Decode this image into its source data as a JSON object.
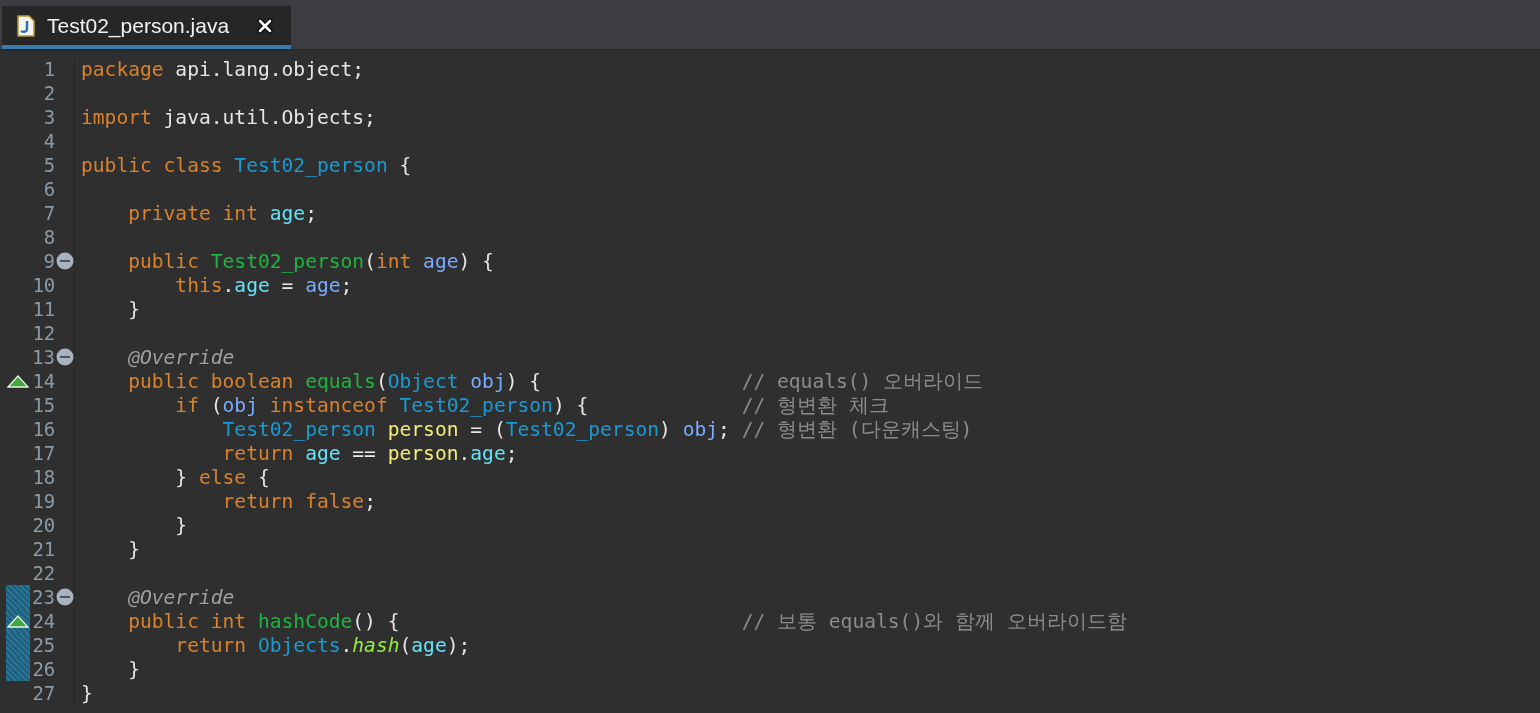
{
  "tabs": [
    {
      "title": "Test02_person.java",
      "selected": true
    }
  ],
  "lines": [
    {
      "number": "1",
      "collapsible": false,
      "overrides": false,
      "highlighted": false,
      "tokens": [
        {
          "text": "package",
          "kind": "keyword"
        },
        {
          "text": " api.lang.object;",
          "kind": "plain"
        }
      ]
    },
    {
      "number": "2",
      "collapsible": false,
      "overrides": false,
      "highlighted": false
    },
    {
      "number": "3",
      "collapsible": false,
      "overrides": false,
      "highlighted": false,
      "tokens": [
        {
          "text": "import",
          "kind": "keyword"
        },
        {
          "text": " java.util.Objects;",
          "kind": "plain"
        }
      ]
    },
    {
      "number": "4",
      "collapsible": false,
      "overrides": false,
      "highlighted": false
    },
    {
      "number": "5",
      "collapsible": false,
      "overrides": false,
      "highlighted": false,
      "tokens": [
        {
          "text": "public class ",
          "kind": "keyword"
        },
        {
          "text": "Test02_person",
          "kind": "type"
        },
        {
          "text": " {",
          "kind": "plain"
        }
      ]
    },
    {
      "number": "6",
      "collapsible": false,
      "overrides": false,
      "highlighted": false
    },
    {
      "number": "7",
      "collapsible": false,
      "overrides": false,
      "highlighted": false,
      "tokens": [
        {
          "text": "    private int ",
          "kind": "keyword"
        },
        {
          "text": "age",
          "kind": "field"
        },
        {
          "text": ";",
          "kind": "plain"
        }
      ]
    },
    {
      "number": "8",
      "collapsible": false,
      "overrides": false,
      "highlighted": false
    },
    {
      "number": "9",
      "collapsible": true,
      "overrides": false,
      "highlighted": false,
      "tokens": [
        {
          "text": "    public ",
          "kind": "keyword"
        },
        {
          "text": "Test02_person",
          "kind": "method"
        },
        {
          "text": "(",
          "kind": "plain"
        },
        {
          "text": "int ",
          "kind": "keyword"
        },
        {
          "text": "age",
          "kind": "param"
        },
        {
          "text": ") {",
          "kind": "plain"
        }
      ]
    },
    {
      "number": "10",
      "collapsible": false,
      "overrides": false,
      "highlighted": false,
      "tokens": [
        {
          "text": "        this",
          "kind": "keyword"
        },
        {
          "text": ".",
          "kind": "plain"
        },
        {
          "text": "age",
          "kind": "field"
        },
        {
          "text": " = ",
          "kind": "plain"
        },
        {
          "text": "age",
          "kind": "param"
        },
        {
          "text": ";",
          "kind": "plain"
        }
      ]
    },
    {
      "number": "11",
      "collapsible": false,
      "overrides": false,
      "highlighted": false,
      "tokens": [
        {
          "text": "    }",
          "kind": "plain"
        }
      ]
    },
    {
      "number": "12",
      "collapsible": false,
      "overrides": false,
      "highlighted": false
    },
    {
      "number": "13",
      "collapsible": true,
      "overrides": false,
      "highlighted": false,
      "tokens": [
        {
          "text": "    @Override",
          "kind": "annotation"
        }
      ]
    },
    {
      "number": "14",
      "collapsible": false,
      "overrides": true,
      "highlighted": false,
      "tokens": [
        {
          "text": "    public boolean ",
          "kind": "keyword"
        },
        {
          "text": "equals",
          "kind": "method"
        },
        {
          "text": "(",
          "kind": "plain"
        },
        {
          "text": "Object ",
          "kind": "type"
        },
        {
          "text": "obj",
          "kind": "param"
        },
        {
          "text": ") {",
          "kind": "plain"
        },
        {
          "text": "// equals() 오버라이드",
          "kind": "comment"
        }
      ]
    },
    {
      "number": "15",
      "collapsible": false,
      "overrides": false,
      "highlighted": false,
      "tokens": [
        {
          "text": "        if ",
          "kind": "keyword"
        },
        {
          "text": "(",
          "kind": "plain"
        },
        {
          "text": "obj",
          "kind": "param"
        },
        {
          "text": " instanceof ",
          "kind": "keyword"
        },
        {
          "text": "Test02_person",
          "kind": "type"
        },
        {
          "text": ") {",
          "kind": "plain"
        },
        {
          "text": "// 형변환 체크",
          "kind": "comment"
        }
      ]
    },
    {
      "number": "16",
      "collapsible": false,
      "overrides": false,
      "highlighted": false,
      "tokens": [
        {
          "text": "            Test02_person ",
          "kind": "type"
        },
        {
          "text": "person",
          "kind": "local"
        },
        {
          "text": " = (",
          "kind": "plain"
        },
        {
          "text": "Test02_person",
          "kind": "type"
        },
        {
          "text": ") ",
          "kind": "plain"
        },
        {
          "text": "obj",
          "kind": "param"
        },
        {
          "text": ";",
          "kind": "plain"
        },
        {
          "text": "// 형변환 (다운캐스팅)",
          "kind": "comment"
        }
      ]
    },
    {
      "number": "17",
      "collapsible": false,
      "overrides": false,
      "highlighted": false,
      "tokens": [
        {
          "text": "            return ",
          "kind": "keyword"
        },
        {
          "text": "age",
          "kind": "field"
        },
        {
          "text": " == ",
          "kind": "plain"
        },
        {
          "text": "person",
          "kind": "local"
        },
        {
          "text": ".",
          "kind": "plain"
        },
        {
          "text": "age",
          "kind": "field"
        },
        {
          "text": ";",
          "kind": "plain"
        }
      ]
    },
    {
      "number": "18",
      "collapsible": false,
      "overrides": false,
      "highlighted": false,
      "tokens": [
        {
          "text": "        } ",
          "kind": "plain"
        },
        {
          "text": "else",
          "kind": "keyword"
        },
        {
          "text": " {",
          "kind": "plain"
        }
      ]
    },
    {
      "number": "19",
      "collapsible": false,
      "overrides": false,
      "highlighted": false,
      "tokens": [
        {
          "text": "            return false",
          "kind": "keyword"
        },
        {
          "text": ";",
          "kind": "plain"
        }
      ]
    },
    {
      "number": "20",
      "collapsible": false,
      "overrides": false,
      "highlighted": false,
      "tokens": [
        {
          "text": "        }",
          "kind": "plain"
        }
      ]
    },
    {
      "number": "21",
      "collapsible": false,
      "overrides": false,
      "highlighted": false,
      "tokens": [
        {
          "text": "    }",
          "kind": "plain"
        }
      ]
    },
    {
      "number": "22",
      "collapsible": false,
      "overrides": false,
      "highlighted": false
    },
    {
      "number": "23",
      "collapsible": true,
      "overrides": false,
      "highlighted": true,
      "tokens": [
        {
          "text": "    @Override",
          "kind": "annotation"
        }
      ]
    },
    {
      "number": "24",
      "collapsible": false,
      "overrides": true,
      "highlighted": true,
      "tokens": [
        {
          "text": "    public int ",
          "kind": "keyword"
        },
        {
          "text": "hashCode",
          "kind": "method"
        },
        {
          "text": "() {",
          "kind": "plain"
        },
        {
          "text": "// 보통 equals()와 함께 오버라이드함",
          "kind": "comment"
        }
      ]
    },
    {
      "number": "25",
      "collapsible": false,
      "overrides": false,
      "highlighted": true,
      "tokens": [
        {
          "text": "        return ",
          "kind": "keyword"
        },
        {
          "text": "Objects",
          "kind": "type"
        },
        {
          "text": ".",
          "kind": "plain"
        },
        {
          "text": "hash",
          "kind": "static-method"
        },
        {
          "text": "(",
          "kind": "plain"
        },
        {
          "text": "age",
          "kind": "field"
        },
        {
          "text": ");",
          "kind": "plain"
        }
      ]
    },
    {
      "number": "26",
      "collapsible": false,
      "overrides": false,
      "highlighted": true,
      "tokens": [
        {
          "text": "    }",
          "kind": "plain"
        }
      ]
    },
    {
      "number": "27",
      "collapsible": false,
      "overrides": false,
      "highlighted": false,
      "tokens": [
        {
          "text": "}",
          "kind": "plain"
        }
      ]
    }
  ]
}
